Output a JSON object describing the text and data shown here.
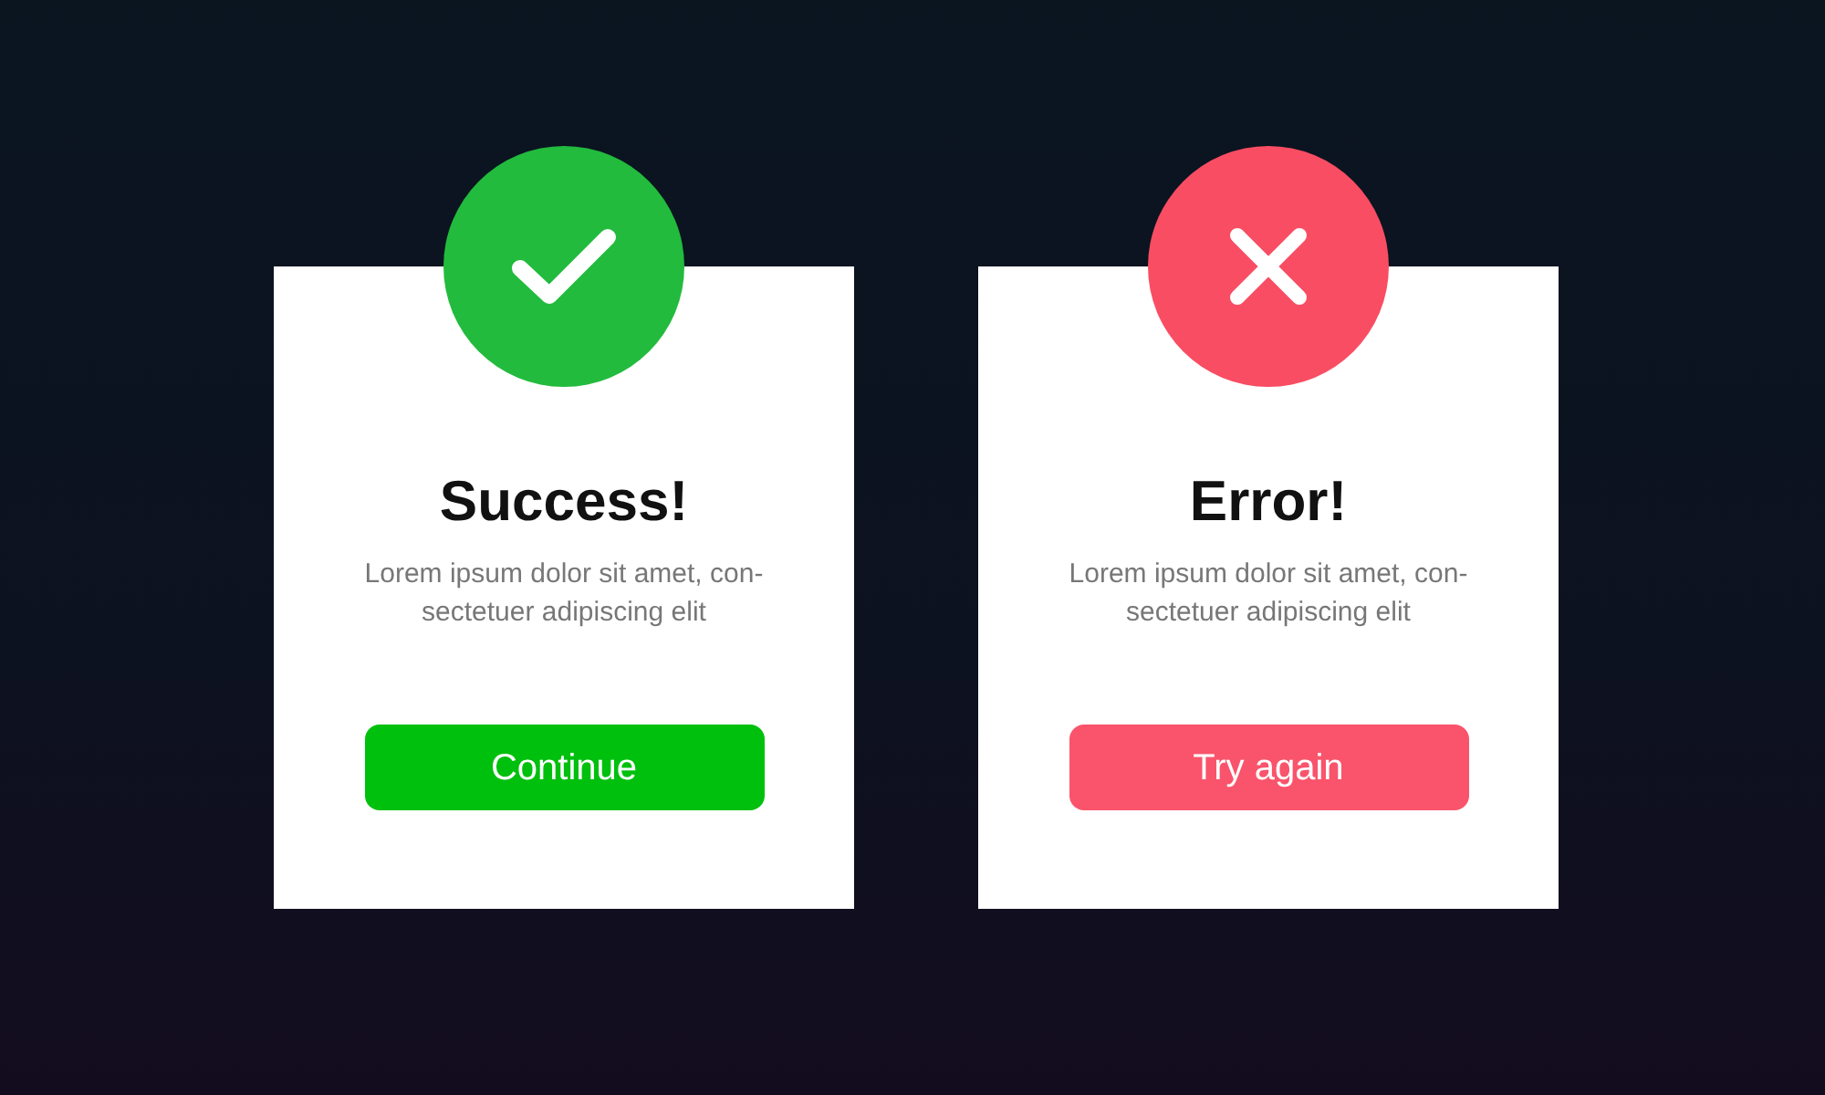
{
  "dialogs": [
    {
      "kind": "success",
      "title": "Success!",
      "message_lines": [
        "Lorem ipsum dolor sit amet, con-",
        "sectetuer adipiscing elit"
      ],
      "button": "Continue"
    },
    {
      "kind": "error",
      "title": "Error!",
      "message_lines": [
        "Lorem ipsum dolor sit amet, con-",
        "sectetuer adipiscing elit"
      ],
      "button": "Try again"
    }
  ]
}
